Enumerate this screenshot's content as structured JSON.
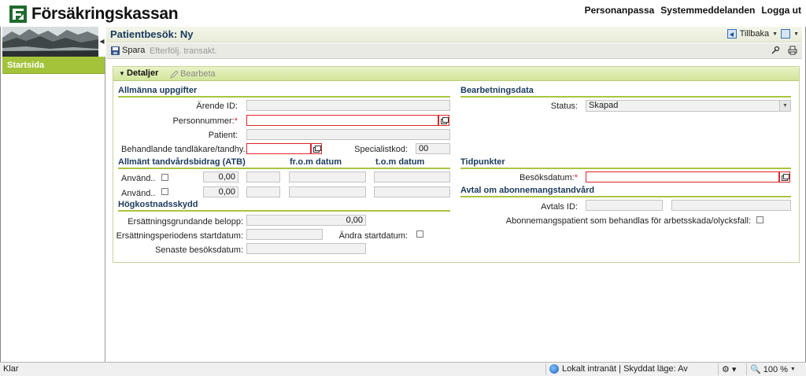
{
  "app": {
    "logo_text": "Försäkringskassan",
    "top_links": [
      "Personanpassa",
      "Systemmeddelanden",
      "Logga ut"
    ]
  },
  "sidebar": {
    "items": [
      {
        "label": "Startsida"
      }
    ]
  },
  "title_bar": {
    "title": "Patientbesök: Ny",
    "back_label": "Tillbaka"
  },
  "toolbar": {
    "save_label": "Spara",
    "followup_label": "Efterfölj. transakt."
  },
  "panel": {
    "header": "Detaljer",
    "edit_label": "Bearbeta"
  },
  "general": {
    "title": "Allmänna uppgifter",
    "arende_label": "Ärende ID:",
    "arende_value": "",
    "personnummer_label": "Personnummer:",
    "required_marker": "*",
    "personnummer_value": "",
    "patient_label": "Patient:",
    "patient_value": "",
    "tandlakare_label": "Behandlande tandläkare/tandhy..",
    "tandlakare_value": "",
    "specialistkod_label": "Specialistkod:",
    "specialistkod_value": "00"
  },
  "atb": {
    "title": "Allmänt tandvårdsbidrag (ATB)",
    "from_label": "fr.o.m datum",
    "to_label": "t.o.m datum",
    "rows": [
      {
        "label": "Använd..",
        "amount": "0,00"
      },
      {
        "label": "Använd..",
        "amount": "0,00"
      }
    ]
  },
  "hogkostnad": {
    "title": "Högkostnadsskydd",
    "belopp_label": "Ersättningsgrundande belopp:",
    "belopp_value": "0,00",
    "startdatum_label": "Ersättningsperiodens startdatum:",
    "andra_label": "Ändra startdatum:",
    "senaste_label": "Senaste besöksdatum:"
  },
  "bearbetning": {
    "title": "Bearbetningsdata",
    "status_label": "Status:",
    "status_value": "Skapad"
  },
  "tidpunkter": {
    "title": "Tidpunkter",
    "besok_label": "Besöksdatum:"
  },
  "avtal": {
    "title": "Avtal om abonnemangstandvård",
    "avtal_label": "Avtals ID:",
    "abonnemang_label": "Abonnemangspatient som behandlas för arbetsskada/olycksfall:"
  },
  "status_bar": {
    "left": "Klar",
    "zone": "Lokalt intranät | Skyddat läge: Av",
    "zoom": "100 %"
  }
}
